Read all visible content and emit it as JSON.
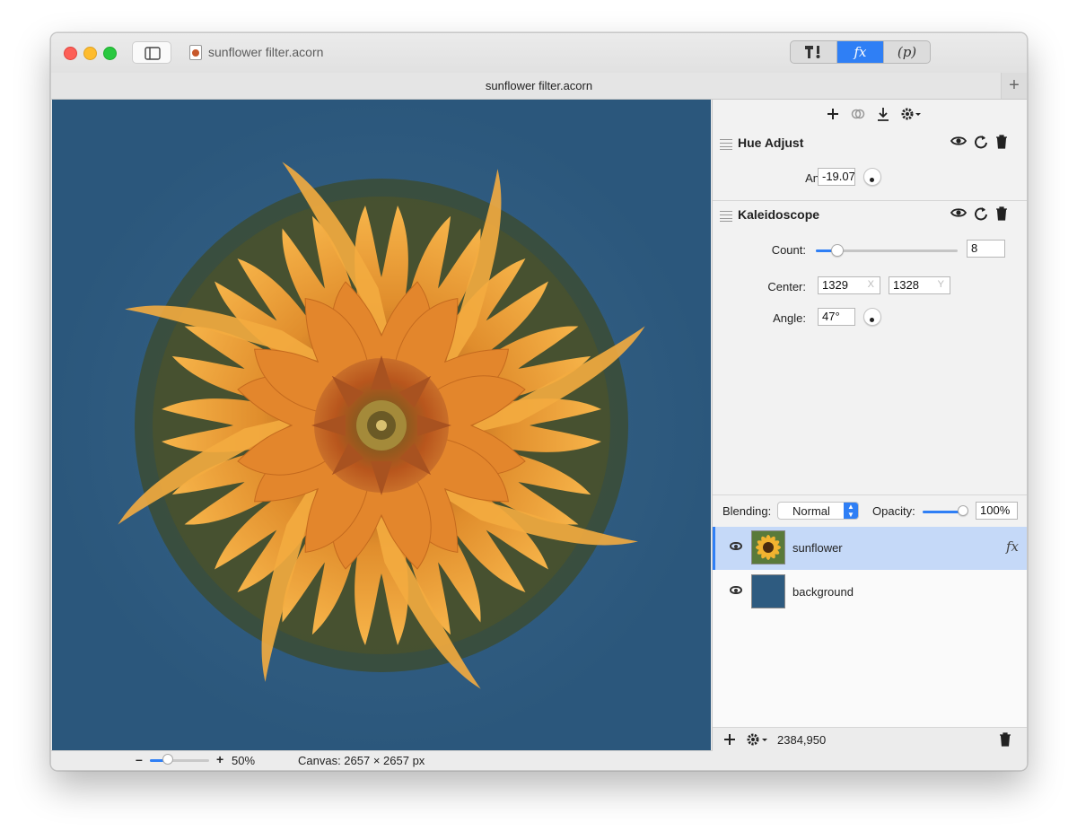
{
  "window": {
    "title": "sunflower filter.acorn",
    "tab_title": "sunflower filter.acorn",
    "tab_add": "+"
  },
  "toolbar": {
    "segments": [
      {
        "label": "T!",
        "icon": "tools-icon"
      },
      {
        "label": "fx",
        "icon": "effects-icon"
      },
      {
        "label": "(p)",
        "icon": "properties-icon"
      }
    ]
  },
  "fx_panel": {
    "toolbar_icons": [
      "plus-icon",
      "link-icon",
      "download-icon",
      "gear-icon"
    ],
    "filters": [
      {
        "name": "Hue Adjust",
        "params": [
          {
            "label": "Angle:",
            "value": "-19.07"
          }
        ]
      },
      {
        "name": "Kaleidoscope",
        "count_label": "Count:",
        "count_value": "8",
        "count_fraction": 0.15,
        "center_label": "Center:",
        "center_x": "1329",
        "center_y": "1328",
        "center_x_suffix": "X",
        "center_y_suffix": "Y",
        "angle_label": "Angle:",
        "angle_value": "47°"
      }
    ]
  },
  "layers_panel": {
    "blending_label": "Blending:",
    "blending_value": "Normal",
    "opacity_label": "Opacity:",
    "opacity_value": "100%",
    "opacity_fraction": 0.9,
    "layers": [
      {
        "name": "sunflower",
        "selected": true,
        "fx": "fx"
      },
      {
        "name": "background",
        "selected": false,
        "color": "#2e5b80"
      }
    ],
    "memory": "2384,950"
  },
  "status": {
    "zoom_minus": "–",
    "zoom_plus": "+",
    "zoom": "50%",
    "zoom_fraction": 0.3,
    "canvas_size": "Canvas: 2657 × 2657 px"
  },
  "colors": {
    "accent": "#2f7ff5",
    "canvas_bg": "#2e5b80",
    "petal": "#f0a43a"
  }
}
